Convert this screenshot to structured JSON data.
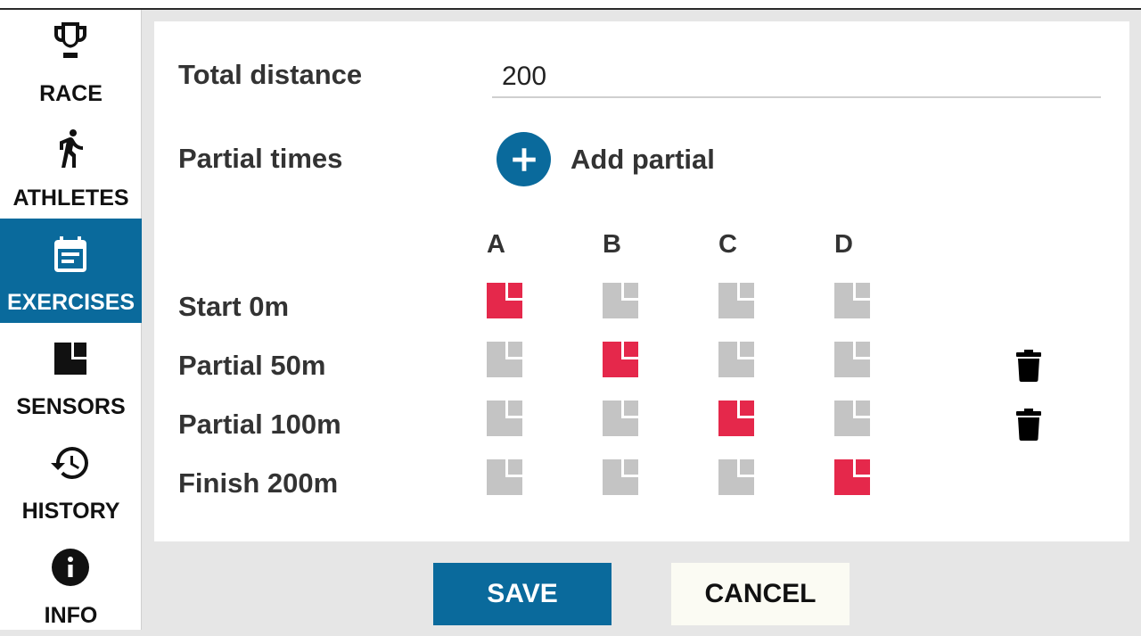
{
  "sidebar": {
    "items": [
      {
        "label": "RACE",
        "icon": "trophy-icon",
        "active": false
      },
      {
        "label": "ATHLETES",
        "icon": "walking-icon",
        "active": false
      },
      {
        "label": "EXERCISES",
        "icon": "calendar-icon",
        "active": true
      },
      {
        "label": "SENSORS",
        "icon": "sensor-icon",
        "active": false
      },
      {
        "label": "HISTORY",
        "icon": "history-icon",
        "active": false
      },
      {
        "label": "INFO",
        "icon": "info-icon",
        "active": false
      }
    ]
  },
  "form": {
    "total_distance_label": "Total distance",
    "total_distance_value": "200",
    "partial_times_label": "Partial times",
    "add_partial_label": "Add partial",
    "columns": [
      "A",
      "B",
      "C",
      "D"
    ],
    "rows": [
      {
        "label": "Start 0m",
        "active_column": "A",
        "deletable": false
      },
      {
        "label": "Partial 50m",
        "active_column": "B",
        "deletable": true
      },
      {
        "label": "Partial 100m",
        "active_column": "C",
        "deletable": true
      },
      {
        "label": "Finish 200m",
        "active_column": "D",
        "deletable": false
      }
    ]
  },
  "buttons": {
    "save": "SAVE",
    "cancel": "CANCEL"
  },
  "colors": {
    "accent": "#0a6a9c",
    "sensor_active": "#e5284b",
    "sensor_inactive": "#c4c4c4"
  }
}
